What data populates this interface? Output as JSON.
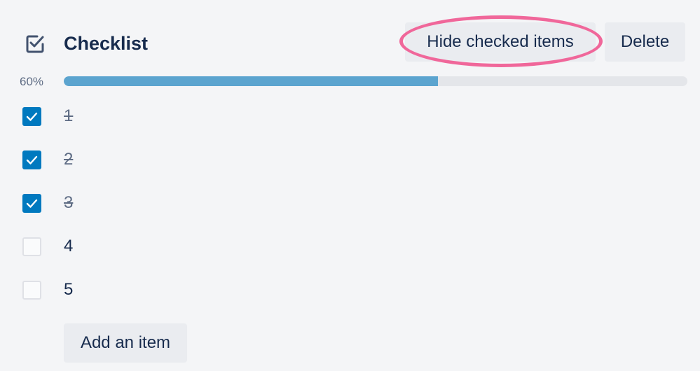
{
  "checklist": {
    "title": "Checklist",
    "icon": "checklist-icon",
    "hide_checked_label": "Hide checked items",
    "delete_label": "Delete",
    "progress_text": "60%",
    "progress_fraction": 0.6,
    "accent_color": "#0079bf",
    "progress_color": "#5ba4cf",
    "highlight_color": "#f0679a",
    "items": [
      {
        "label": "1",
        "checked": true
      },
      {
        "label": "2",
        "checked": true
      },
      {
        "label": "3",
        "checked": true
      },
      {
        "label": "4",
        "checked": false
      },
      {
        "label": "5",
        "checked": false
      }
    ],
    "add_item_label": "Add an item"
  }
}
